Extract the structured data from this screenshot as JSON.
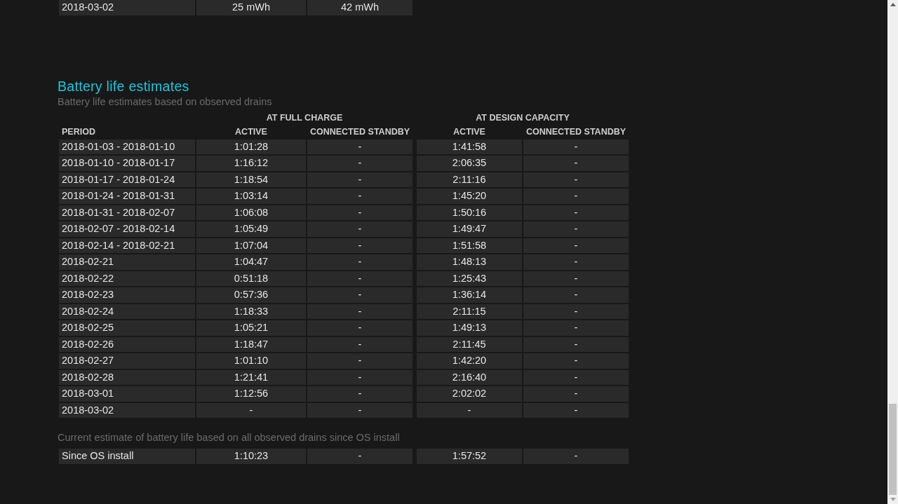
{
  "previous_table": {
    "rows": [
      [
        "2018-03-02",
        "25 mWh",
        "42 mWh"
      ]
    ]
  },
  "section": {
    "title": "Battery life estimates",
    "subtitle": "Battery life estimates based on observed drains"
  },
  "estimates_table": {
    "group_headers": [
      "AT FULL CHARGE",
      "AT DESIGN CAPACITY"
    ],
    "columns": [
      "PERIOD",
      "ACTIVE",
      "CONNECTED STANDBY",
      "ACTIVE",
      "CONNECTED STANDBY"
    ],
    "rows": [
      [
        "2018-01-03 - 2018-01-10",
        "1:01:28",
        "-",
        "1:41:58",
        "-"
      ],
      [
        "2018-01-10 - 2018-01-17",
        "1:16:12",
        "-",
        "2:06:35",
        "-"
      ],
      [
        "2018-01-17 - 2018-01-24",
        "1:18:54",
        "-",
        "2:11:16",
        "-"
      ],
      [
        "2018-01-24 - 2018-01-31",
        "1:03:14",
        "-",
        "1:45:20",
        "-"
      ],
      [
        "2018-01-31 - 2018-02-07",
        "1:06:08",
        "-",
        "1:50:16",
        "-"
      ],
      [
        "2018-02-07 - 2018-02-14",
        "1:05:49",
        "-",
        "1:49:47",
        "-"
      ],
      [
        "2018-02-14 - 2018-02-21",
        "1:07:04",
        "-",
        "1:51:58",
        "-"
      ],
      [
        "2018-02-21",
        "1:04:47",
        "-",
        "1:48:13",
        "-"
      ],
      [
        "2018-02-22",
        "0:51:18",
        "-",
        "1:25:43",
        "-"
      ],
      [
        "2018-02-23",
        "0:57:36",
        "-",
        "1:36:14",
        "-"
      ],
      [
        "2018-02-24",
        "1:18:33",
        "-",
        "2:11:15",
        "-"
      ],
      [
        "2018-02-25",
        "1:05:21",
        "-",
        "1:49:13",
        "-"
      ],
      [
        "2018-02-26",
        "1:18:47",
        "-",
        "2:11:45",
        "-"
      ],
      [
        "2018-02-27",
        "1:01:10",
        "-",
        "1:42:20",
        "-"
      ],
      [
        "2018-02-28",
        "1:21:41",
        "-",
        "2:16:40",
        "-"
      ],
      [
        "2018-03-01",
        "1:12:56",
        "-",
        "2:02:02",
        "-"
      ],
      [
        "2018-03-02",
        "-",
        "-",
        "-",
        "-"
      ]
    ]
  },
  "os_install_note": "Current estimate of battery life based on all observed drains since OS install",
  "os_install_table": {
    "rows": [
      [
        "Since OS install",
        "1:10:23",
        "-",
        "1:57:52",
        "-"
      ]
    ]
  }
}
